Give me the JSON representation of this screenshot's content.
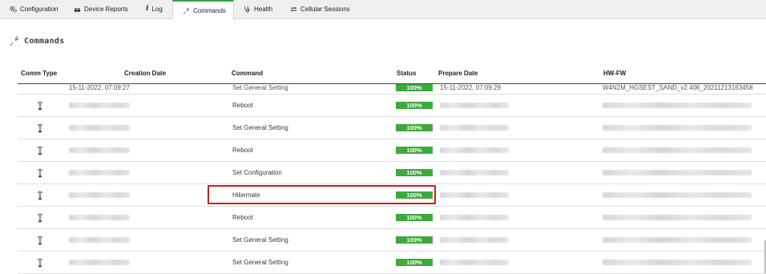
{
  "tabs": [
    {
      "label": "Configuration",
      "icon": "gears-icon",
      "active": false
    },
    {
      "label": "Device Reports",
      "icon": "car-icon",
      "active": false
    },
    {
      "label": "Log",
      "icon": "info-icon",
      "active": false
    },
    {
      "label": "Commands",
      "icon": "wrench-icon",
      "active": true
    },
    {
      "label": "Health",
      "icon": "stethoscope-icon",
      "active": false
    },
    {
      "label": "Cellular Sessions",
      "icon": "exchange-icon",
      "active": false
    }
  ],
  "section_title": "Commands",
  "table": {
    "headers": {
      "comm_type": "Comm Type",
      "creation_date": "Creation Date",
      "command": "Command",
      "status": "Status",
      "prepare_date": "Prepare Date",
      "hw_fw": "HW-FW"
    },
    "partial_row": {
      "creation_date": "15-11-2022, 07:09:27",
      "command": "Set General Setting",
      "status": "100%",
      "prepare_date": "15-11-2022, 07:09:29",
      "hw_fw": "W4N2M_HGSEST_SAND_v2.406_20211213163458"
    },
    "rows": [
      {
        "command": "Reboot",
        "status": "100%"
      },
      {
        "command": "Set General Setting",
        "status": "100%"
      },
      {
        "command": "Reboot",
        "status": "100%"
      },
      {
        "command": "Set Configuration",
        "status": "100%"
      },
      {
        "command": "Hibernate",
        "status": "100%",
        "highlighted": true
      },
      {
        "command": "Reboot",
        "status": "100%"
      },
      {
        "command": "Set General Setting",
        "status": "100%"
      },
      {
        "command": "Set General Setting",
        "status": "100%"
      }
    ]
  },
  "colors": {
    "status_green": "#3caa3c",
    "active_tab_accent": "#3aa14a",
    "highlight_red": "#cc1c1c"
  }
}
